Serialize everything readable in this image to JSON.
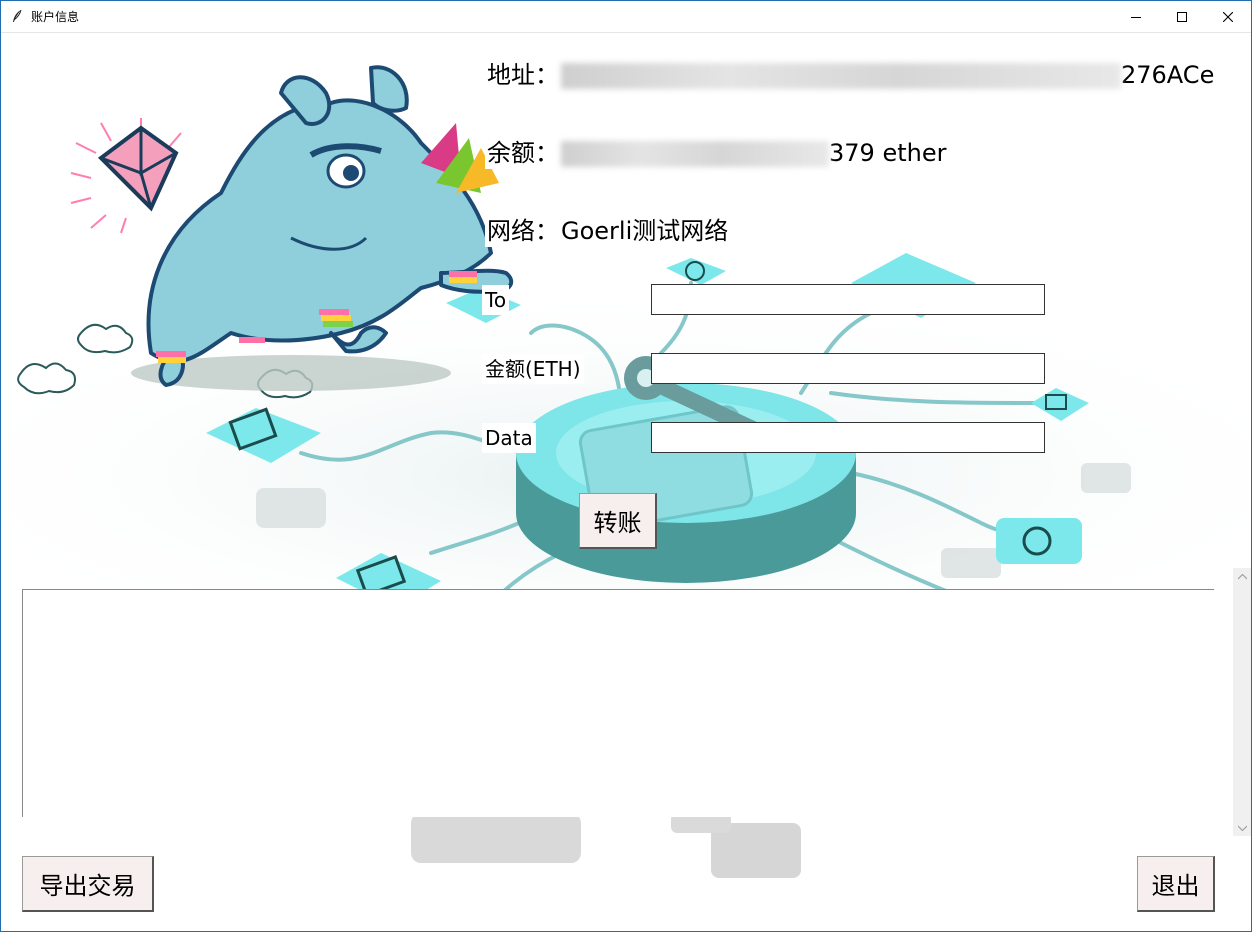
{
  "window": {
    "title": "账户信息",
    "controls": {
      "minimize": "minimize-icon",
      "maximize": "maximize-icon",
      "close": "close-icon"
    }
  },
  "account": {
    "address_label": "地址：",
    "address_visible_suffix": "276ACe",
    "balance_label": "余额：",
    "balance_visible_suffix": "379 ether",
    "network_label": "网络：",
    "network_value": "Goerli测试网络"
  },
  "form": {
    "to_label": "To",
    "amount_label": "金额(ETH)",
    "data_label": "Data",
    "to_value": "",
    "amount_value": "",
    "data_value": "",
    "transfer_button": "转账"
  },
  "footer": {
    "export_button": "导出交易",
    "exit_button": "退出"
  },
  "colors": {
    "rhino": "#8fcfd9",
    "teal": "#6fdde3",
    "button_bg": "#f7efed"
  }
}
